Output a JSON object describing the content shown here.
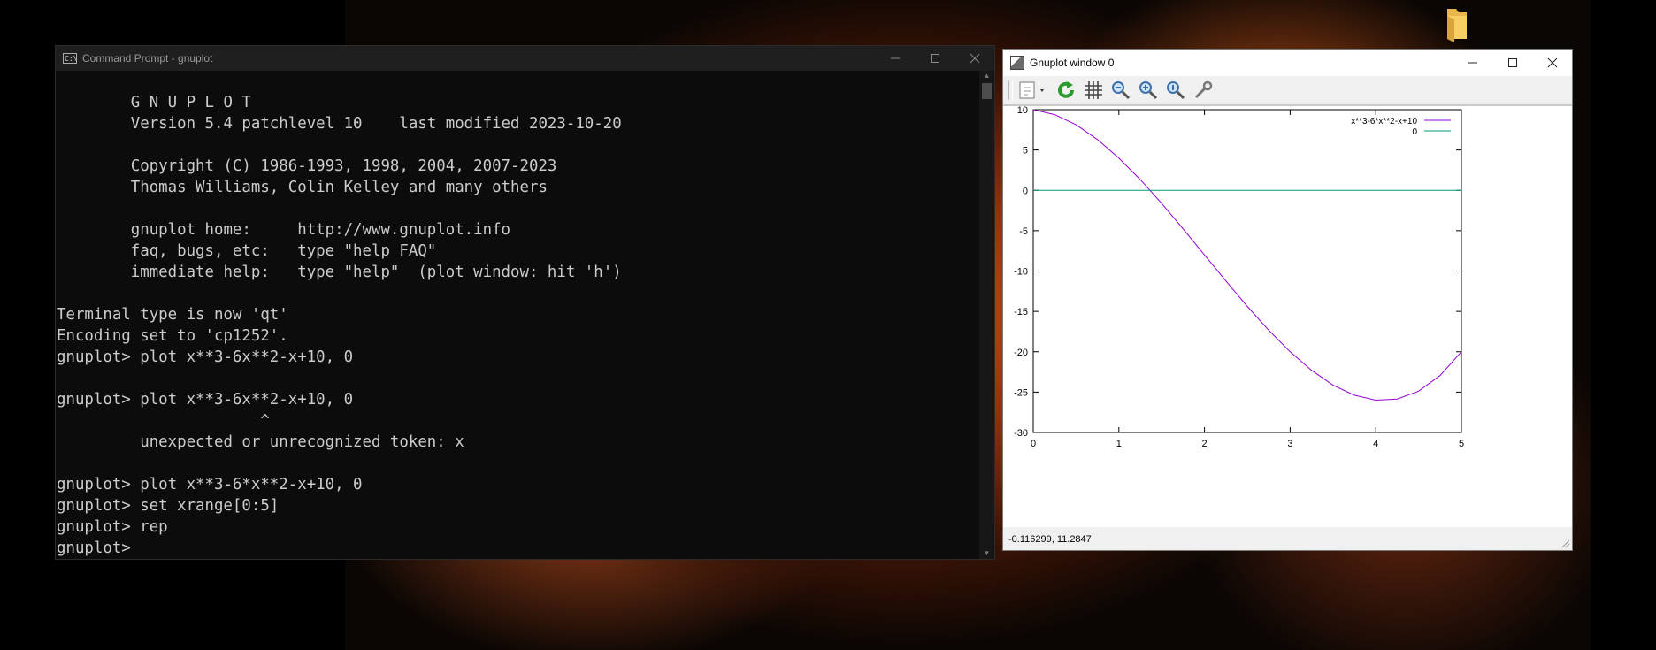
{
  "colors": {
    "terminal_bg": "#0c0c0c",
    "terminal_text": "#cccccc",
    "curve": "#9400d3",
    "zero_line": "#009e73",
    "desktop_accent": "#c4561a"
  },
  "desktop": {
    "folder_icon": "folder-icon"
  },
  "cmd_window": {
    "title": "Command Prompt - gnuplot",
    "icon": "cmd-icon",
    "icon_label": "C:\\",
    "lines": [
      "",
      "        G N U P L O T",
      "        Version 5.4 patchlevel 10    last modified 2023-10-20",
      "",
      "        Copyright (C) 1986-1993, 1998, 2004, 2007-2023",
      "        Thomas Williams, Colin Kelley and many others",
      "",
      "        gnuplot home:     http://www.gnuplot.info",
      "        faq, bugs, etc:   type \"help FAQ\"",
      "        immediate help:   type \"help\"  (plot window: hit 'h')",
      "",
      "Terminal type is now 'qt'",
      "Encoding set to 'cp1252'.",
      "gnuplot> plot x**3-6x**2-x+10, 0",
      "",
      "gnuplot> plot x**3-6x**2-x+10, 0",
      "                      ^",
      "         unexpected or unrecognized token: x",
      "",
      "gnuplot> plot x**3-6*x**2-x+10, 0",
      "gnuplot> set xrange[0:5]",
      "gnuplot> rep",
      "gnuplot> "
    ]
  },
  "gnuplot_window": {
    "title": "Gnuplot window 0",
    "toolbar_icons": [
      "export-icon",
      "replot-icon",
      "grid-icon",
      "zoom-out-icon",
      "zoom-in-icon",
      "zoom-previous-icon",
      "settings-icon"
    ],
    "status": "-0.116299,  11.2847"
  },
  "chart_data": {
    "type": "line",
    "title": "",
    "xlabel": "",
    "ylabel": "",
    "xlim": [
      0,
      5
    ],
    "ylim": [
      -30,
      10
    ],
    "x_ticks": [
      "0",
      "1",
      "2",
      "3",
      "4",
      "5"
    ],
    "y_ticks": [
      "10",
      "5",
      "0",
      "-5",
      "-10",
      "-15",
      "-20",
      "-25",
      "-30"
    ],
    "grid": false,
    "legend_position": "top-right",
    "series": [
      {
        "name": "x**3-6*x**2-x+10",
        "color": "#9400d3",
        "x": [
          0,
          0.25,
          0.5,
          0.75,
          1,
          1.25,
          1.5,
          1.75,
          2,
          2.25,
          2.5,
          2.75,
          3,
          3.25,
          3.5,
          3.75,
          4,
          4.25,
          4.5,
          4.75,
          5
        ],
        "y": [
          10,
          9.39,
          8.13,
          6.3,
          4.0,
          1.33,
          -1.63,
          -4.77,
          -8.0,
          -11.23,
          -14.38,
          -17.33,
          -20.0,
          -22.3,
          -24.13,
          -25.39,
          -26.0,
          -25.86,
          -24.88,
          -22.95,
          -20.0
        ]
      },
      {
        "name": "0",
        "color": "#009e73",
        "x": [
          0,
          5
        ],
        "y": [
          0,
          0
        ]
      }
    ]
  }
}
